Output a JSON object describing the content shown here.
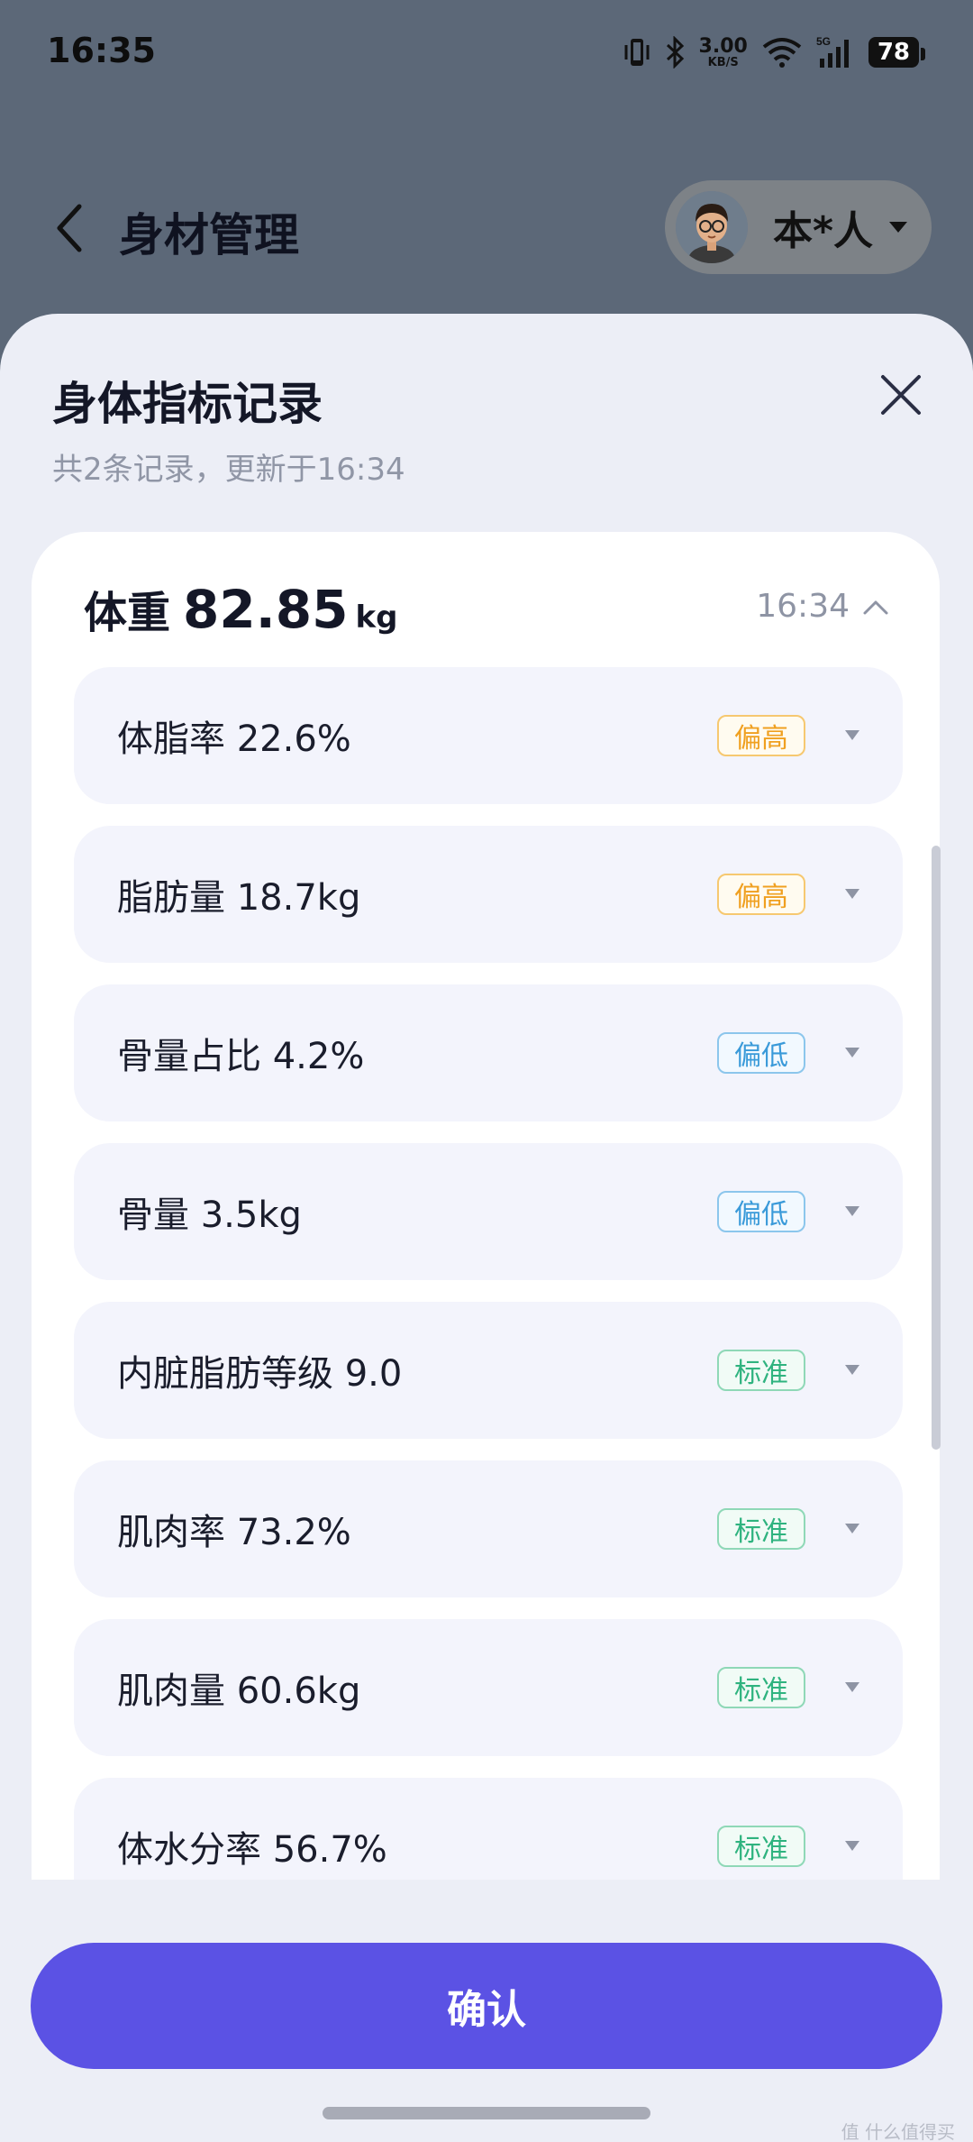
{
  "status_bar": {
    "time": "16:35",
    "net_speed_value": "3.00",
    "net_speed_unit": "KB/S",
    "network_type": "5G",
    "battery": "78",
    "icons": [
      "vibrate-icon",
      "bluetooth-icon",
      "wifi-icon",
      "signal-icon",
      "battery-icon"
    ]
  },
  "header": {
    "title": "身材管理",
    "user_name": "本*人"
  },
  "sheet": {
    "title": "身体指标记录",
    "subtitle": "共2条记录，更新于16:34",
    "record": {
      "weight_label": "体重",
      "weight_value": "82.85",
      "weight_unit": "kg",
      "time": "16:34",
      "metrics": [
        {
          "label": "体脂率 22.6%",
          "badge": "偏高",
          "status": "high"
        },
        {
          "label": "脂肪量 18.7kg",
          "badge": "偏高",
          "status": "high"
        },
        {
          "label": "骨量占比 4.2%",
          "badge": "偏低",
          "status": "low"
        },
        {
          "label": "骨量 3.5kg",
          "badge": "偏低",
          "status": "low"
        },
        {
          "label": "内脏脂肪等级 9.0",
          "badge": "标准",
          "status": "normal"
        },
        {
          "label": "肌肉率 73.2%",
          "badge": "标准",
          "status": "normal"
        },
        {
          "label": "肌肉量 60.6kg",
          "badge": "标准",
          "status": "normal"
        },
        {
          "label": "体水分率 56.7%",
          "badge": "标准",
          "status": "normal"
        }
      ]
    },
    "confirm_label": "确认"
  },
  "watermark": "值 什么值得买",
  "colors": {
    "accent": "#5b52e4",
    "high": "#f0a020",
    "low": "#3a9ad9",
    "normal": "#2fb37f"
  }
}
